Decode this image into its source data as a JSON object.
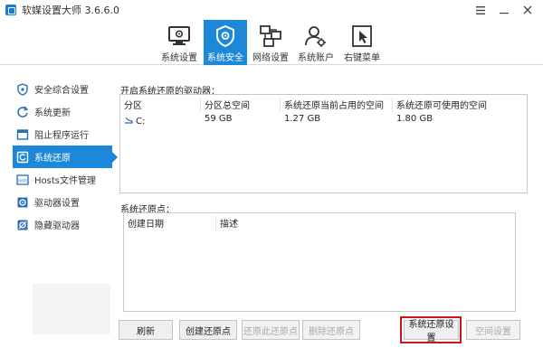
{
  "window": {
    "title": "软媒设置大师 3.6.6.0"
  },
  "toolbar": {
    "tabs": [
      {
        "label": "系统设置",
        "icon": "system-settings-icon"
      },
      {
        "label": "系统安全",
        "icon": "shield-icon",
        "active": true
      },
      {
        "label": "网络设置",
        "icon": "network-icon"
      },
      {
        "label": "系统账户",
        "icon": "user-accounts-icon"
      },
      {
        "label": "右键菜单",
        "icon": "cursor-menu-icon"
      }
    ]
  },
  "sidebar": {
    "items": [
      {
        "label": "安全综合设置",
        "icon": "shield-settings-icon"
      },
      {
        "label": "系统更新",
        "icon": "refresh-icon"
      },
      {
        "label": "阻止程序运行",
        "icon": "block-program-icon"
      },
      {
        "label": "系统还原",
        "icon": "restore-icon",
        "active": true
      },
      {
        "label": "Hosts文件管理",
        "icon": "hosts-icon"
      },
      {
        "label": "驱动器设置",
        "icon": "drive-settings-icon"
      },
      {
        "label": "隐藏驱动器",
        "icon": "hide-drive-icon"
      }
    ]
  },
  "drives": {
    "label": "开启系统还原的驱动器：",
    "columns": [
      "分区",
      "分区总空间",
      "系统还原当前占用的空间",
      "系统还原可使用的空间"
    ],
    "rows": [
      [
        "C:",
        "59 GB",
        "1.27 GB",
        "1.80 GB"
      ]
    ]
  },
  "restore_points": {
    "label": "系统还原点：",
    "columns": [
      "创建日期",
      "描述"
    ]
  },
  "buttons": {
    "refresh": "刷新",
    "create": "创建还原点",
    "restore": "还原此还原点",
    "delete": "删除还原点",
    "settings": "系统还原设置",
    "space": "空间设置"
  },
  "colors": {
    "accent": "#1e88d8",
    "highlight": "#c8161d"
  }
}
